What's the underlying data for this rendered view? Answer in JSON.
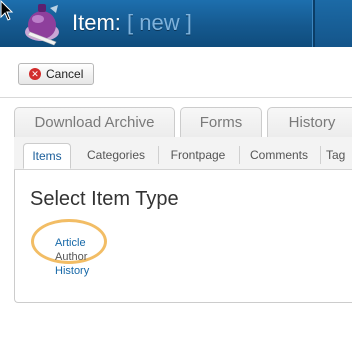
{
  "header": {
    "title_prefix": "Item:",
    "title_status": "[ new ]"
  },
  "toolbar": {
    "cancel_label": "Cancel"
  },
  "outer_tabs": [
    {
      "label": "Download Archive"
    },
    {
      "label": "Forms"
    },
    {
      "label": "History"
    }
  ],
  "inner_tabs": [
    {
      "label": "Items",
      "active": true
    },
    {
      "label": "Categories"
    },
    {
      "label": "Frontpage"
    },
    {
      "label": "Comments"
    },
    {
      "label": "Tag"
    }
  ],
  "main": {
    "section_title": "Select Item Type",
    "item_types": [
      {
        "label": "Article"
      },
      {
        "label": "Author"
      },
      {
        "label": "History"
      }
    ]
  },
  "colors": {
    "header_blue": "#15598f",
    "link_blue": "#1668a8",
    "highlight_orange": "#f0b24a",
    "cancel_red": "#d22c2c"
  }
}
